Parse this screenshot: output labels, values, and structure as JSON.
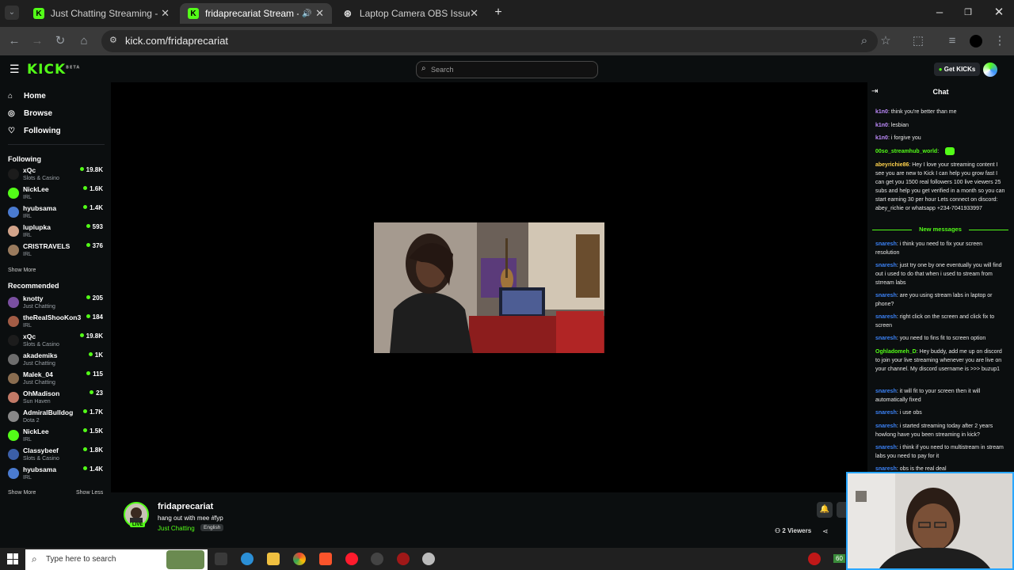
{
  "browser": {
    "tabs": [
      {
        "label": "Just Chatting Streaming - Live Stream",
        "icon": "kick"
      },
      {
        "label": "fridaprecariat Stream - Watch Live",
        "icon": "kick"
      },
      {
        "label": "Laptop Camera OBS Issue",
        "icon": "chatgpt"
      }
    ],
    "url": "kick.com/fridaprecariat"
  },
  "header": {
    "logo": "KICK",
    "logo_sup": "BETA",
    "search_placeholder": "Search",
    "get_kicks": "Get KICKs"
  },
  "sidebar": {
    "nav": [
      {
        "label": "Home",
        "icon": "home-icon"
      },
      {
        "label": "Browse",
        "icon": "compass-icon"
      },
      {
        "label": "Following",
        "icon": "heart-icon"
      }
    ],
    "following_title": "Following",
    "following": [
      {
        "name": "xQc",
        "category": "Slots & Casino",
        "viewers": "19.8K",
        "color": "#1c1c1c"
      },
      {
        "name": "NickLee",
        "category": "IRL",
        "viewers": "1.6K",
        "color": "#53fc18"
      },
      {
        "name": "hyubsama",
        "category": "IRL",
        "viewers": "1.4K",
        "color": "#4a7bd0"
      },
      {
        "name": "luplupka",
        "category": "IRL",
        "viewers": "593",
        "color": "#d3a48a"
      },
      {
        "name": "CRISTRAVELS",
        "category": "IRL",
        "viewers": "376",
        "color": "#9a7b5d"
      }
    ],
    "show_more_1": "Show More",
    "recommended_title": "Recommended",
    "recommended": [
      {
        "name": "knotty",
        "category": "Just Chatting",
        "viewers": "205",
        "color": "#7a4fa0"
      },
      {
        "name": "theRealShooKon3",
        "category": "IRL",
        "viewers": "184",
        "color": "#a25c45"
      },
      {
        "name": "xQc",
        "category": "Slots & Casino",
        "viewers": "19.8K",
        "color": "#1c1c1c"
      },
      {
        "name": "akademiks",
        "category": "Just Chatting",
        "viewers": "1K",
        "color": "#6d6d6d"
      },
      {
        "name": "Malek_04",
        "category": "Just Chatting",
        "viewers": "115",
        "color": "#8a6d50"
      },
      {
        "name": "OhMadison",
        "category": "Sun Haven",
        "viewers": "23",
        "color": "#c27a67"
      },
      {
        "name": "AdmiralBulldog",
        "category": "Dota 2",
        "viewers": "1.7K",
        "color": "#888"
      },
      {
        "name": "NickLee",
        "category": "IRL",
        "viewers": "1.5K",
        "color": "#53fc18"
      },
      {
        "name": "Classybeef",
        "category": "Slots & Casino",
        "viewers": "1.8K",
        "color": "#3b5fa8"
      },
      {
        "name": "hyubsama",
        "category": "IRL",
        "viewers": "1.4K",
        "color": "#4a7bd0"
      }
    ],
    "show_more_2": "Show More",
    "show_less": "Show Less"
  },
  "stream": {
    "name": "fridaprecariat",
    "title": "hang out with mee #fyp",
    "category": "Just Chatting",
    "language": "English",
    "live": "LIVE",
    "viewers": "2 Viewers"
  },
  "chat": {
    "title": "Chat",
    "messages": [
      {
        "user": "k1n0",
        "text": "think you're better than me",
        "color": "#c08cff"
      },
      {
        "user": "k1n0",
        "text": "lesbian",
        "color": "#c08cff"
      },
      {
        "user": "k1n0",
        "text": "i forgive you",
        "color": "#c08cff"
      },
      {
        "user": "00so_streamhub_world",
        "text": "",
        "color": "#53fc18"
      },
      {
        "user": "abeyrichie86",
        "text": "Hey I love your streaming content I see you are new to Kick I can help you grow fast I can get you 1500 real followers 100 live viewers 25 subs and help you get verified in a month so you can start earning 30 per hour Lets connect on discord: abey_richie or whatsapp +234-7041933997",
        "color": "#ffd34d"
      }
    ],
    "new_messages": "New messages",
    "new": [
      {
        "user": "snaresh",
        "text": "i think you need to fix your screen resolution",
        "color": "#3b82f6"
      },
      {
        "user": "snaresh",
        "text": "just try one by one eventually you will find out i used to do that when i used to stream from strream labs",
        "color": "#3b82f6"
      },
      {
        "user": "snaresh",
        "text": "are you using stream labs in laptop or phone?",
        "color": "#3b82f6"
      },
      {
        "user": "snaresh",
        "text": "right click on the screen and click fix to screen",
        "color": "#3b82f6"
      },
      {
        "user": "snaresh",
        "text": "you need to fins fit to screen option",
        "color": "#3b82f6"
      },
      {
        "user": "Oghladomeh_D",
        "text": "Hey buddy, add me up on discord to join your live streaming whenever you are live on your channel. My discord username is >>> buzup1",
        "color": "#53fc18"
      },
      {
        "user": "snaresh",
        "text": "it will fit to your screen then it will automatically fixed",
        "color": "#3b82f6"
      },
      {
        "user": "snaresh",
        "text": "i use obs",
        "color": "#3b82f6"
      },
      {
        "user": "snaresh",
        "text": "i started streaming today after 2 years howlong have you been streaming in kick?",
        "color": "#3b82f6"
      },
      {
        "user": "snaresh",
        "text": "i think if you need to multistream in stream labs you need to pay for it",
        "color": "#3b82f6"
      },
      {
        "user": "snaresh",
        "text": "obs is the real deal",
        "color": "#3b82f6"
      }
    ]
  },
  "taskbar": {
    "search_placeholder": "Type here to search",
    "clock_badge": "60"
  }
}
